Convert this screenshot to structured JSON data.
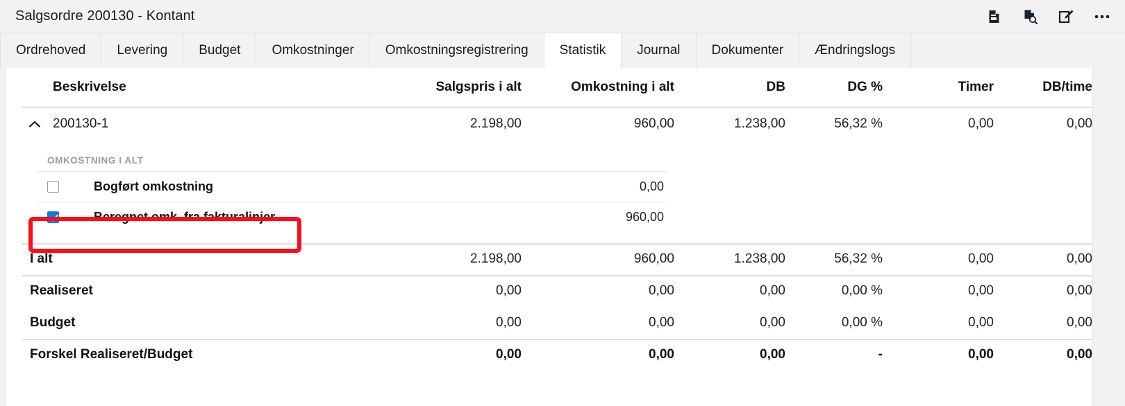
{
  "window": {
    "title": "Salgsordre 200130 - Kontant",
    "actions": [
      {
        "name": "document-details-icon",
        "label": "Vis dokumentdetaljer"
      },
      {
        "name": "document-search-icon",
        "label": "Søg i dokument"
      },
      {
        "name": "edit-icon",
        "label": "Rediger"
      },
      {
        "name": "more-options-icon",
        "label": "Flere indstillinger"
      }
    ]
  },
  "tabs": [
    {
      "label": "Ordrehoved",
      "active": false
    },
    {
      "label": "Levering",
      "active": false
    },
    {
      "label": "Budget",
      "active": false
    },
    {
      "label": "Omkostninger",
      "active": false
    },
    {
      "label": "Omkostningsregistrering",
      "active": false
    },
    {
      "label": "Statistik",
      "active": true
    },
    {
      "label": "Journal",
      "active": false
    },
    {
      "label": "Dokumenter",
      "active": false
    },
    {
      "label": "Ændringslogs",
      "active": false
    }
  ],
  "table": {
    "columns": [
      "Beskrivelse",
      "Salgspris i alt",
      "Omkostning i alt",
      "DB",
      "DG %",
      "Timer",
      "DB/time"
    ],
    "expanded_row": {
      "expand_icon": "chevron-up-icon",
      "description": "200130-1",
      "salgspris": "2.198,00",
      "omkostning": "960,00",
      "db": "1.238,00",
      "dg": "56,32 %",
      "timer": "0,00",
      "db_time": "0,00"
    },
    "detail_section": {
      "label": "OMKOSTNING I ALT",
      "items": [
        {
          "label": "Bogført omkostning",
          "value": "0,00",
          "checked": false
        },
        {
          "label": "Beregnet omk. fra fakturalinjer",
          "value": "960,00",
          "checked": true
        }
      ]
    },
    "summary_rows": [
      {
        "label": "I alt",
        "salgspris": "2.198,00",
        "omkostning": "960,00",
        "db": "1.238,00",
        "dg": "56,32 %",
        "timer": "0,00",
        "db_time": "0,00",
        "bold_values": false
      },
      {
        "label": "Realiseret",
        "salgspris": "0,00",
        "omkostning": "0,00",
        "db": "0,00",
        "dg": "0,00 %",
        "timer": "0,00",
        "db_time": "0,00",
        "bold_values": false
      },
      {
        "label": "Budget",
        "salgspris": "0,00",
        "omkostning": "0,00",
        "db": "0,00",
        "dg": "0,00 %",
        "timer": "0,00",
        "db_time": "0,00",
        "bold_values": false
      },
      {
        "label": "Forskel Realiseret/Budget",
        "salgspris": "0,00",
        "omkostning": "0,00",
        "db": "0,00",
        "dg": "-",
        "timer": "0,00",
        "db_time": "0,00",
        "bold_values": true
      }
    ]
  },
  "annotation": {
    "name": "red-highlight-box",
    "color": "#fc0d1b",
    "targets": "Beregnet omk. fra fakturalinjer"
  },
  "colors": {
    "accent_checkbox": "#0a7ae3",
    "annotation": "#fc0d1b",
    "chrome_bg": "#f2f2f2",
    "panel_bg": "#ffffff"
  }
}
